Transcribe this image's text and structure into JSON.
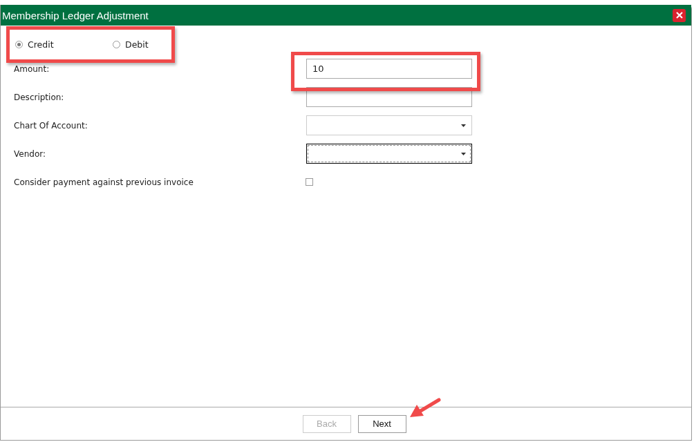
{
  "window": {
    "title": "Membership Ledger Adjustment"
  },
  "entry_type": [
    {
      "label": "Credit",
      "selected": true
    },
    {
      "label": "Debit",
      "selected": false
    }
  ],
  "fields": [
    {
      "kind": "text",
      "label": "Amount:",
      "value": "10",
      "focused": false
    },
    {
      "kind": "text",
      "label": "Description:",
      "focused": false
    },
    {
      "kind": "dropdown",
      "label": "Chart Of Account:",
      "focused": false
    },
    {
      "kind": "dropdown",
      "label": "Vendor:",
      "focused": true
    },
    {
      "kind": "checkbox",
      "label": "Consider payment against previous invoice",
      "checked": false
    }
  ],
  "buttons": [
    {
      "label": "Back",
      "disabled": true
    },
    {
      "label": "Next",
      "disabled": false
    }
  ]
}
